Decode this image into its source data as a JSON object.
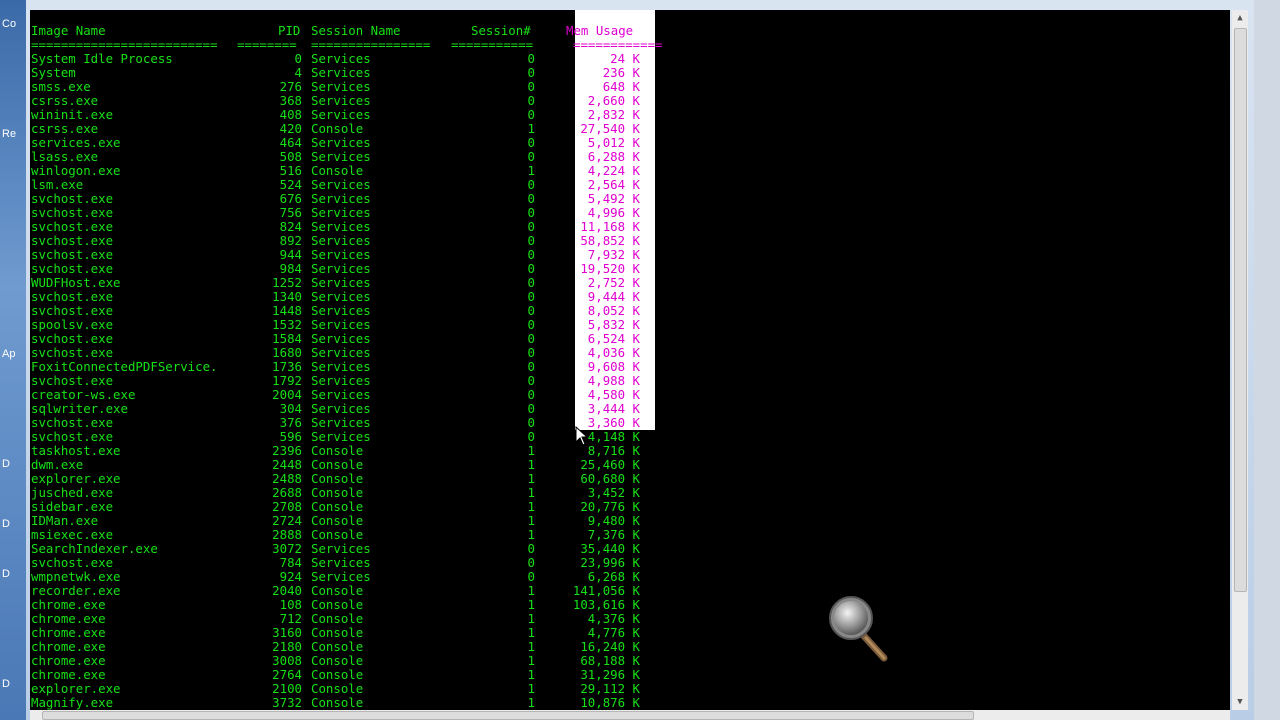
{
  "console": {
    "header": {
      "image_name": "Image Name",
      "pid": "PID",
      "session_name": "Session Name",
      "session_num": "Session#",
      "mem_usage": "Mem Usage"
    },
    "separator": {
      "name": "=========================",
      "pid": "========",
      "session": "================",
      "num": "===========",
      "mem": "============"
    },
    "rows": [
      {
        "name": "System Idle Process",
        "pid": "0",
        "session": "Services",
        "num": "0",
        "mem": "24 K"
      },
      {
        "name": "System",
        "pid": "4",
        "session": "Services",
        "num": "0",
        "mem": "236 K"
      },
      {
        "name": "smss.exe",
        "pid": "276",
        "session": "Services",
        "num": "0",
        "mem": "648 K"
      },
      {
        "name": "csrss.exe",
        "pid": "368",
        "session": "Services",
        "num": "0",
        "mem": "2,660 K"
      },
      {
        "name": "wininit.exe",
        "pid": "408",
        "session": "Services",
        "num": "0",
        "mem": "2,832 K"
      },
      {
        "name": "csrss.exe",
        "pid": "420",
        "session": "Console",
        "num": "1",
        "mem": "27,540 K"
      },
      {
        "name": "services.exe",
        "pid": "464",
        "session": "Services",
        "num": "0",
        "mem": "5,012 K"
      },
      {
        "name": "lsass.exe",
        "pid": "508",
        "session": "Services",
        "num": "0",
        "mem": "6,288 K"
      },
      {
        "name": "winlogon.exe",
        "pid": "516",
        "session": "Console",
        "num": "1",
        "mem": "4,224 K"
      },
      {
        "name": "lsm.exe",
        "pid": "524",
        "session": "Services",
        "num": "0",
        "mem": "2,564 K"
      },
      {
        "name": "svchost.exe",
        "pid": "676",
        "session": "Services",
        "num": "0",
        "mem": "5,492 K"
      },
      {
        "name": "svchost.exe",
        "pid": "756",
        "session": "Services",
        "num": "0",
        "mem": "4,996 K"
      },
      {
        "name": "svchost.exe",
        "pid": "824",
        "session": "Services",
        "num": "0",
        "mem": "11,168 K"
      },
      {
        "name": "svchost.exe",
        "pid": "892",
        "session": "Services",
        "num": "0",
        "mem": "58,852 K"
      },
      {
        "name": "svchost.exe",
        "pid": "944",
        "session": "Services",
        "num": "0",
        "mem": "7,932 K"
      },
      {
        "name": "svchost.exe",
        "pid": "984",
        "session": "Services",
        "num": "0",
        "mem": "19,520 K"
      },
      {
        "name": "WUDFHost.exe",
        "pid": "1252",
        "session": "Services",
        "num": "0",
        "mem": "2,752 K"
      },
      {
        "name": "svchost.exe",
        "pid": "1340",
        "session": "Services",
        "num": "0",
        "mem": "9,444 K"
      },
      {
        "name": "svchost.exe",
        "pid": "1448",
        "session": "Services",
        "num": "0",
        "mem": "8,052 K"
      },
      {
        "name": "spoolsv.exe",
        "pid": "1532",
        "session": "Services",
        "num": "0",
        "mem": "5,832 K"
      },
      {
        "name": "svchost.exe",
        "pid": "1584",
        "session": "Services",
        "num": "0",
        "mem": "6,524 K"
      },
      {
        "name": "svchost.exe",
        "pid": "1680",
        "session": "Services",
        "num": "0",
        "mem": "4,036 K"
      },
      {
        "name": "FoxitConnectedPDFService.",
        "pid": "1736",
        "session": "Services",
        "num": "0",
        "mem": "9,608 K"
      },
      {
        "name": "svchost.exe",
        "pid": "1792",
        "session": "Services",
        "num": "0",
        "mem": "4,988 K"
      },
      {
        "name": "creator-ws.exe",
        "pid": "2004",
        "session": "Services",
        "num": "0",
        "mem": "4,580 K"
      },
      {
        "name": "sqlwriter.exe",
        "pid": "304",
        "session": "Services",
        "num": "0",
        "mem": "3,444 K"
      },
      {
        "name": "svchost.exe",
        "pid": "376",
        "session": "Services",
        "num": "0",
        "mem": "3,360 K"
      },
      {
        "name": "svchost.exe",
        "pid": "596",
        "session": "Services",
        "num": "0",
        "mem": "4,148 K"
      },
      {
        "name": "taskhost.exe",
        "pid": "2396",
        "session": "Console",
        "num": "1",
        "mem": "8,716 K"
      },
      {
        "name": "dwm.exe",
        "pid": "2448",
        "session": "Console",
        "num": "1",
        "mem": "25,460 K"
      },
      {
        "name": "explorer.exe",
        "pid": "2488",
        "session": "Console",
        "num": "1",
        "mem": "60,680 K"
      },
      {
        "name": "jusched.exe",
        "pid": "2688",
        "session": "Console",
        "num": "1",
        "mem": "3,452 K"
      },
      {
        "name": "sidebar.exe",
        "pid": "2708",
        "session": "Console",
        "num": "1",
        "mem": "20,776 K"
      },
      {
        "name": "IDMan.exe",
        "pid": "2724",
        "session": "Console",
        "num": "1",
        "mem": "9,480 K"
      },
      {
        "name": "msiexec.exe",
        "pid": "2888",
        "session": "Console",
        "num": "1",
        "mem": "7,376 K"
      },
      {
        "name": "SearchIndexer.exe",
        "pid": "3072",
        "session": "Services",
        "num": "0",
        "mem": "35,440 K"
      },
      {
        "name": "svchost.exe",
        "pid": "784",
        "session": "Services",
        "num": "0",
        "mem": "23,996 K"
      },
      {
        "name": "wmpnetwk.exe",
        "pid": "924",
        "session": "Services",
        "num": "0",
        "mem": "6,268 K"
      },
      {
        "name": "recorder.exe",
        "pid": "2040",
        "session": "Console",
        "num": "1",
        "mem": "141,056 K"
      },
      {
        "name": "chrome.exe",
        "pid": "108",
        "session": "Console",
        "num": "1",
        "mem": "103,616 K"
      },
      {
        "name": "chrome.exe",
        "pid": "712",
        "session": "Console",
        "num": "1",
        "mem": "4,376 K"
      },
      {
        "name": "chrome.exe",
        "pid": "3160",
        "session": "Console",
        "num": "1",
        "mem": "4,776 K"
      },
      {
        "name": "chrome.exe",
        "pid": "2180",
        "session": "Console",
        "num": "1",
        "mem": "16,240 K"
      },
      {
        "name": "chrome.exe",
        "pid": "3008",
        "session": "Console",
        "num": "1",
        "mem": "68,188 K"
      },
      {
        "name": "chrome.exe",
        "pid": "2764",
        "session": "Console",
        "num": "1",
        "mem": "31,296 K"
      },
      {
        "name": "explorer.exe",
        "pid": "2100",
        "session": "Console",
        "num": "1",
        "mem": "29,112 K"
      },
      {
        "name": "Magnify.exe",
        "pid": "3732",
        "session": "Console",
        "num": "1",
        "mem": "10,876 K"
      }
    ],
    "selected_rows": 27
  },
  "desktop_icon_letters": [
    "Co",
    "Re",
    "Ap",
    "D",
    "D",
    "D",
    "D"
  ],
  "colors": {
    "console_bg": "#000000",
    "text_green": "#17e017",
    "selection_text": "#e000d0",
    "selection_bg": "#ffffff"
  },
  "icons": [
    "magnifier-icon",
    "mouse-cursor-icon",
    "scroll-up-arrow-icon",
    "scroll-down-arrow-icon",
    "scroll-right-arrow-icon"
  ]
}
